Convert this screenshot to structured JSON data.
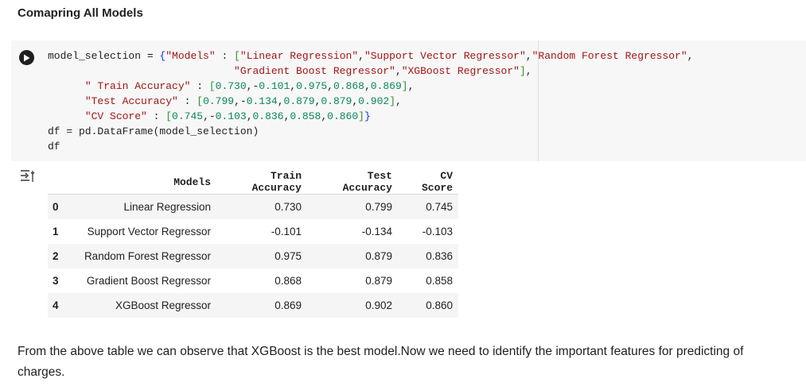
{
  "heading": "Comapring All Models",
  "code": {
    "lines": [
      "model_selection = {\"Models\" : [\"Linear Regression\",\"Support Vector Regressor\",\"Random Forest Regressor\",",
      "                              \"Gradient Boost Regressor\",\"XGBoost Regressor\"],",
      "      \" Train Accuracy\" : [0.730,-0.101,0.975,0.868,0.869],",
      "      \"Test Accuracy\" : [0.799,-0.134,0.879,0.879,0.902],",
      "      \"CV Score\" : [0.745,-0.103,0.836,0.858,0.860]}",
      "df = pd.DataFrame(model_selection)",
      "df"
    ]
  },
  "icons": {
    "run": "play-icon",
    "output": "output-toggle-icon"
  },
  "table": {
    "columns": [
      "",
      "Models",
      "Train Accuracy",
      "Test Accuracy",
      "CV Score"
    ],
    "rows": [
      [
        "0",
        "Linear Regression",
        "0.730",
        "0.799",
        "0.745"
      ],
      [
        "1",
        "Support Vector Regressor",
        "-0.101",
        "-0.134",
        "-0.103"
      ],
      [
        "2",
        "Random Forest Regressor",
        "0.975",
        "0.879",
        "0.836"
      ],
      [
        "3",
        "Gradient Boost Regressor",
        "0.868",
        "0.879",
        "0.858"
      ],
      [
        "4",
        "XGBoost Regressor",
        "0.869",
        "0.902",
        "0.860"
      ]
    ]
  },
  "description": "From the above table we can observe that XGBoost is the best model.Now we need to identify the important features for predicting of charges."
}
